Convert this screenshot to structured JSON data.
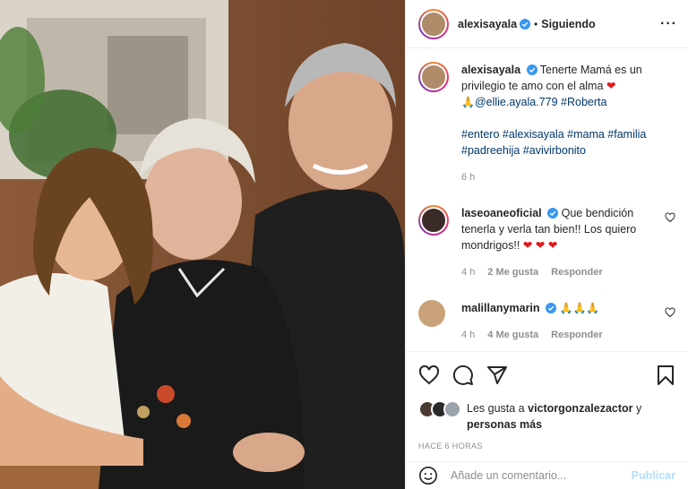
{
  "post": {
    "author": "alexisayala",
    "following_label": "Siguiendo",
    "separator": "•",
    "more_label": "···"
  },
  "caption": {
    "user": "alexisayala",
    "text": "Tenerte Mamá es un privilegio te amo con el alma",
    "heart": "❤",
    "pray": "🙏",
    "mentions": "@ellie.ayala.779 #Roberta",
    "hashtags": "#entero #alexisayala #mama #familia #padreehija #avivirbonito",
    "time": "6 h"
  },
  "comments": [
    {
      "user": "laseoaneoficial",
      "text": "Que bendición tenerla y verla tan bien!! Los quiero mondrigos!!",
      "hearts": "❤ ❤ ❤",
      "time": "4 h",
      "likes": "2 Me gusta",
      "reply": "Responder"
    },
    {
      "user": "malillanymarin",
      "text": "🙏🙏🙏",
      "time": "4 h",
      "likes": "4 Me gusta",
      "reply": "Responder"
    }
  ],
  "likes": {
    "prefix": "Les gusta a",
    "user": "victorgonzalezactor",
    "and": "y",
    "others": "personas más"
  },
  "timestamp": "HACE 6 HORAS",
  "composer": {
    "placeholder": "Añade un comentario...",
    "publish": "Publicar"
  },
  "colors": {
    "verified": "#3897f0",
    "link": "#00376b",
    "muted": "#8e8e8e",
    "publish_disabled": "#b2dffc"
  },
  "icons": [
    "verified-badge-icon",
    "heart-icon",
    "comment-icon",
    "share-icon",
    "bookmark-icon",
    "emoji-icon",
    "more-icon"
  ]
}
